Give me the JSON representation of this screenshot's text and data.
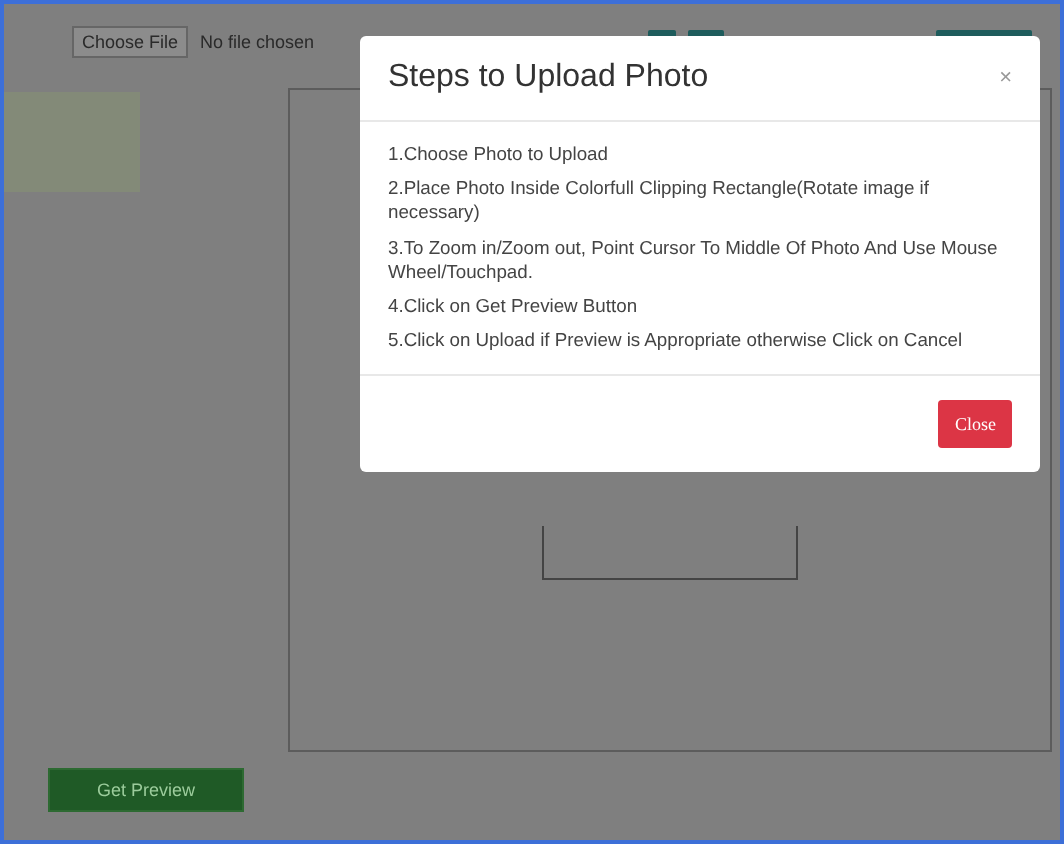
{
  "file_input": {
    "button": "Choose File",
    "status": "No file chosen"
  },
  "preview_button": "Get Preview",
  "modal": {
    "title": "Steps to Upload Photo",
    "close_icon": "×",
    "steps": [
      "1.Choose Photo to Upload",
      "2.Place Photo Inside Colorfull Clipping Rectangle(Rotate image if necessary)",
      "3.To Zoom in/Zoom out, Point Cursor To Middle Of Photo And Use Mouse Wheel/Touchpad.",
      "4.Click on Get Preview Button",
      "5.Click on Upload if Preview is Appropriate otherwise Click on Cancel"
    ],
    "close_button": "Close"
  }
}
